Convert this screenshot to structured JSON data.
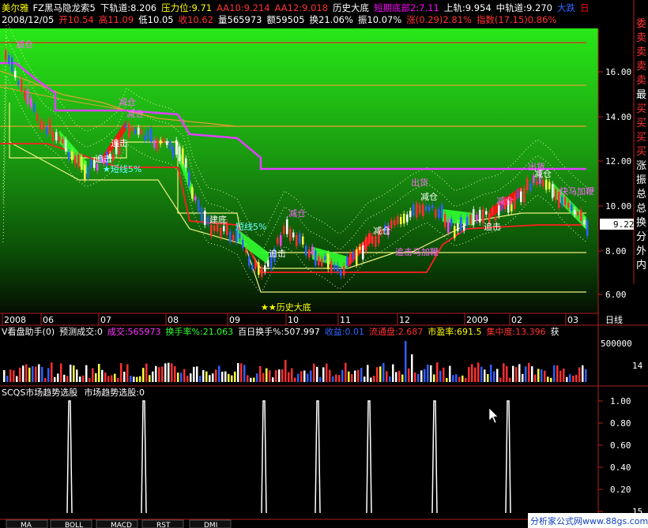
{
  "header": {
    "stock_name": "美尔雅",
    "indicator_name": "FZ黑马隐龙索5",
    "items1": [
      {
        "text": "下轨道:8.206",
        "color": "#ffffff"
      },
      {
        "text": "压力位:9.71",
        "color": "#ffff00"
      },
      {
        "text": "AA10:9.214",
        "color": "#ff3333"
      },
      {
        "text": "AA12:9.018",
        "color": "#ff3333"
      },
      {
        "text": "历史大底",
        "color": "#ffffff"
      },
      {
        "text": "短期底部2:7.11",
        "color": "#ff00ff"
      },
      {
        "text": "上轨:9.954",
        "color": "#ffffff"
      },
      {
        "text": "中轨道:9.270",
        "color": "#ffffff"
      },
      {
        "text": "大跌",
        "color": "#3366ff"
      },
      {
        "text": "日",
        "color": "#ff0000"
      }
    ],
    "date": "2008/12/05",
    "items2": [
      {
        "text": "开10.54",
        "color": "#ff3333"
      },
      {
        "text": "高11.09",
        "color": "#ff3333"
      },
      {
        "text": "低10.05",
        "color": "#ffffff"
      },
      {
        "text": "收10.62",
        "color": "#ff3333"
      },
      {
        "text": "量565973",
        "color": "#ffffff"
      },
      {
        "text": "额59505",
        "color": "#ffffff"
      },
      {
        "text": "换21.06%",
        "color": "#ffffff"
      },
      {
        "text": "振10.07%",
        "color": "#ffffff"
      },
      {
        "text": "涨(0.29)2.81%",
        "color": "#ff3333"
      },
      {
        "text": "指数(17.15)0.86%",
        "color": "#ff3333"
      }
    ]
  },
  "right_labels": [
    "委",
    "卖",
    "卖",
    "卖",
    "卖",
    "最",
    "买",
    "买",
    "买",
    "买",
    "涨",
    "振",
    "总",
    "总",
    "换",
    "分",
    "外",
    "内"
  ],
  "price_axis": {
    "ticks": [
      "16.00",
      "14.00",
      "12.00",
      "10.00",
      "8.00",
      "6.00"
    ],
    "current": "9.22"
  },
  "time_axis": {
    "labels": [
      "2008",
      "06",
      "07",
      "08",
      "09",
      "10",
      "11",
      "12",
      "2009",
      "02",
      "03"
    ],
    "period": "日线"
  },
  "annotations": [
    {
      "text": "减仓",
      "color": "#ff66ff"
    },
    {
      "text": "减仓",
      "color": "#ff66ff"
    },
    {
      "text": "减仓",
      "color": "#ff66ff"
    },
    {
      "text": "追击",
      "color": "#ffffff"
    },
    {
      "text": "★短线5%",
      "color": "#66ffff"
    },
    {
      "text": "建底",
      "color": "#ffffff"
    },
    {
      "text": "短线5%",
      "color": "#66ffff"
    },
    {
      "text": "追击",
      "color": "#ffffff"
    },
    {
      "text": "减仓",
      "color": "#ff66ff"
    },
    {
      "text": "追击",
      "color": "#ffffff"
    },
    {
      "text": "减仓",
      "color": "#ffffff"
    },
    {
      "text": "追击马加鞭",
      "color": "#ff66ff"
    },
    {
      "text": "出货",
      "color": "#ff66ff"
    },
    {
      "text": "减仓",
      "color": "#ffffff"
    },
    {
      "text": "追击",
      "color": "#ffffff"
    },
    {
      "text": "减仓",
      "color": "#ff66ff"
    },
    {
      "text": "出货",
      "color": "#ff66ff"
    },
    {
      "text": "减仓",
      "color": "#ffffff"
    },
    {
      "text": "快马加鞭",
      "color": "#ff66ff"
    },
    {
      "text": "★★历史大底",
      "color": "#ffff00"
    }
  ],
  "vol_header": [
    {
      "text": "V看盘助手(0)",
      "color": "#ffffff"
    },
    {
      "text": "预测成交:0",
      "color": "#ffffff"
    },
    {
      "text": "成交:565973",
      "color": "#ff33ff"
    },
    {
      "text": "换手率%:21.063",
      "color": "#33ff33"
    },
    {
      "text": "百日换手%:507.997",
      "color": "#ffffff"
    },
    {
      "text": "收益:0.01",
      "color": "#3366ff"
    },
    {
      "text": "流通盘:2.687",
      "color": "#ff3333"
    },
    {
      "text": "市盈率:691.5",
      "color": "#ffff00"
    },
    {
      "text": "集中度:13.396",
      "color": "#ff3333"
    },
    {
      "text": "获",
      "color": "#ffffff"
    }
  ],
  "vol_axis": {
    "ticks": [
      "500000",
      "14"
    ]
  },
  "sig_header": [
    {
      "text": "SCQS市场趋势选股",
      "color": "#ffffff"
    },
    {
      "text": "市场趋势选股:0",
      "color": "#ffffff"
    }
  ],
  "sig_axis": {
    "ticks": [
      "1.00",
      "0.80",
      "0.60",
      "0.40",
      "0.20",
      "15"
    ]
  },
  "bottom_tabs": [
    "MA",
    "BOLL",
    "MACD",
    "RST",
    "DMI"
  ],
  "watermark": "分析家公式网www.88gs.com"
}
